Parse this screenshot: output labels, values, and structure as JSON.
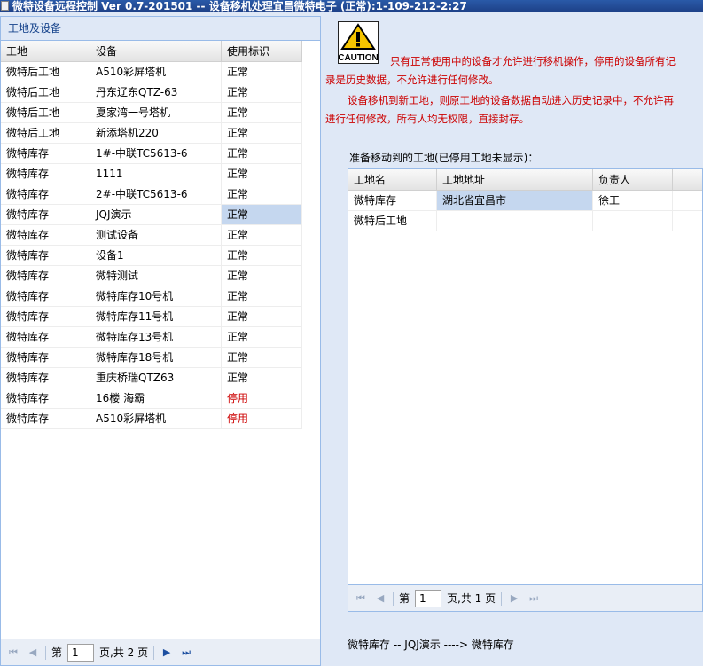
{
  "window": {
    "title": "微特设备远程控制 Ver 0.7-201501 -- 设备移机处理宜昌微特电子 (正常):1-109-212-2:27"
  },
  "left_panel": {
    "header": "工地及设备",
    "columns": [
      "工地",
      "设备",
      "使用标识"
    ],
    "rows": [
      [
        "微特后工地",
        "A510彩屏塔机",
        "正常"
      ],
      [
        "微特后工地",
        "丹东辽东QTZ-63",
        "正常"
      ],
      [
        "微特后工地",
        "夏家湾一号塔机",
        "正常"
      ],
      [
        "微特后工地",
        "新添塔机220",
        "正常"
      ],
      [
        "微特库存",
        "1#-中联TC5613-6",
        "正常"
      ],
      [
        "微特库存",
        "1111",
        "正常"
      ],
      [
        "微特库存",
        "2#-中联TC5613-6",
        "正常"
      ],
      [
        "微特库存",
        "JQJ演示",
        "正常"
      ],
      [
        "微特库存",
        "测试设备",
        "正常"
      ],
      [
        "微特库存",
        "设备1",
        "正常"
      ],
      [
        "微特库存",
        "微特测试",
        "正常"
      ],
      [
        "微特库存",
        "微特库存10号机",
        "正常"
      ],
      [
        "微特库存",
        "微特库存11号机",
        "正常"
      ],
      [
        "微特库存",
        "微特库存13号机",
        "正常"
      ],
      [
        "微特库存",
        "微特库存18号机",
        "正常"
      ],
      [
        "微特库存",
        "重庆桥瑞QTZ63",
        "正常"
      ],
      [
        "微特库存",
        "16楼 海霸",
        "停用"
      ],
      [
        "微特库存",
        "A510彩屏塔机",
        "停用"
      ]
    ],
    "pager": {
      "page_label": "第",
      "page_value": "1",
      "total_label": "页,共 2 页"
    }
  },
  "caution": {
    "label": "CAUTION"
  },
  "warnings": {
    "line1": "只有正常使用中的设备才允许进行移机操作，停用的设备所有记",
    "line2": "录是历史数据，不允许进行任何修改。",
    "line3": "设备移机到新工地，则原工地的设备数据自动进入历史记录中，不允许再",
    "line4": "进行任何修改，所有人均无权限，直接封存。"
  },
  "target": {
    "label": "准备移动到的工地(已停用工地未显示)：",
    "columns": [
      "工地名",
      "工地地址",
      "负责人"
    ],
    "rows": [
      [
        "微特库存",
        "湖北省宜昌市",
        "徐工"
      ],
      [
        "微特后工地",
        "",
        ""
      ]
    ],
    "pager": {
      "page_label": "第",
      "page_value": "1",
      "total_label": "页,共 1 页"
    }
  },
  "move_status": "微特库存 -- JQJ演示 ----> 微特库存"
}
